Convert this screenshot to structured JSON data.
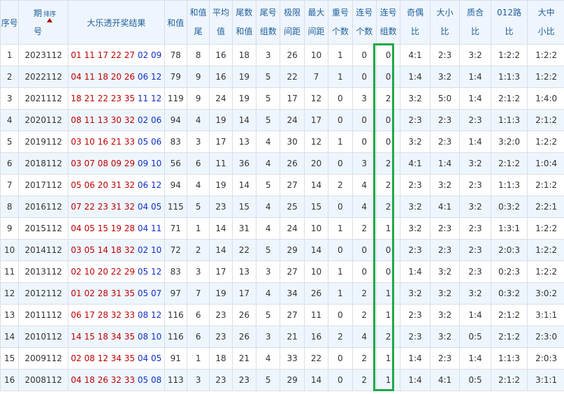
{
  "headers": {
    "xuhao": "序号",
    "qi_top": "期",
    "qi_bottom": "号",
    "sort_label": "排序",
    "result": "大乐透开奖结果",
    "hezhi": "和值",
    "hzw_top": "和值",
    "hzw_bottom": "尾",
    "pj_top": "平均",
    "pj_bottom": "值",
    "wshz_top": "尾数",
    "wshz_bottom": "和值",
    "whzs_top": "尾号",
    "whzs_bottom": "组数",
    "jxjj_top": "极限",
    "jxjj_bottom": "间距",
    "zdjj_top": "最大",
    "zdjj_bottom": "间距",
    "chg_top": "重号",
    "chg_bottom": "个数",
    "lhgs_top": "连号",
    "lhgs_bottom": "个数",
    "lhzs_top": "连号",
    "lhzs_bottom": "组数",
    "jo_top": "奇偶",
    "jo_bottom": "比",
    "dx_top": "大小",
    "dx_bottom": "比",
    "zh_top": "质合",
    "zh_bottom": "比",
    "lu_top": "012路",
    "lu_bottom": "比",
    "dzx_top": "大中",
    "dzx_bottom": "小比"
  },
  "rows": [
    {
      "n": "1",
      "period": "2023112",
      "red": "01 11 17 22 27",
      "blue": "02 09",
      "sum": "78",
      "tail": "8",
      "avg": "16",
      "tsum": "18",
      "tg": "3",
      "jx": "26",
      "zd": "10",
      "ch": "1",
      "lh": "0",
      "lz": "0",
      "jo": "4:1",
      "dx": "2:3",
      "zh": "3:2",
      "lu": "1:2:2",
      "dzx": "1:2:2"
    },
    {
      "n": "2",
      "period": "2022112",
      "red": "04 11 18 20 26",
      "blue": "06 12",
      "sum": "79",
      "tail": "9",
      "avg": "16",
      "tsum": "19",
      "tg": "5",
      "jx": "22",
      "zd": "7",
      "ch": "1",
      "lh": "0",
      "lz": "0",
      "jo": "1:4",
      "dx": "3:2",
      "zh": "1:4",
      "lu": "1:1:3",
      "dzx": "1:2:2"
    },
    {
      "n": "3",
      "period": "2021112",
      "red": "18 21 22 23 35",
      "blue": "11 12",
      "sum": "119",
      "tail": "9",
      "avg": "24",
      "tsum": "19",
      "tg": "5",
      "jx": "17",
      "zd": "12",
      "ch": "0",
      "lh": "3",
      "lz": "2",
      "jo": "3:2",
      "dx": "5:0",
      "zh": "1:4",
      "lu": "2:1:2",
      "dzx": "1:4:0"
    },
    {
      "n": "4",
      "period": "2020112",
      "red": "08 11 13 30 32",
      "blue": "02 06",
      "sum": "94",
      "tail": "4",
      "avg": "19",
      "tsum": "14",
      "tg": "5",
      "jx": "24",
      "zd": "17",
      "ch": "0",
      "lh": "0",
      "lz": "0",
      "jo": "2:3",
      "dx": "2:3",
      "zh": "2:3",
      "lu": "1:1:3",
      "dzx": "2:1:2"
    },
    {
      "n": "5",
      "period": "2019112",
      "red": "03 10 16 21 33",
      "blue": "05 06",
      "sum": "83",
      "tail": "3",
      "avg": "17",
      "tsum": "13",
      "tg": "4",
      "jx": "30",
      "zd": "12",
      "ch": "1",
      "lh": "0",
      "lz": "0",
      "jo": "3:2",
      "dx": "2:3",
      "zh": "1:4",
      "lu": "3:2:0",
      "dzx": "1:2:2"
    },
    {
      "n": "6",
      "period": "2018112",
      "red": "03 07 08 09 29",
      "blue": "09 10",
      "sum": "56",
      "tail": "6",
      "avg": "11",
      "tsum": "36",
      "tg": "4",
      "jx": "26",
      "zd": "20",
      "ch": "0",
      "lh": "3",
      "lz": "2",
      "jo": "4:1",
      "dx": "1:4",
      "zh": "3:2",
      "lu": "2:1:2",
      "dzx": "1:0:4"
    },
    {
      "n": "7",
      "period": "2017112",
      "red": "05 06 20 31 32",
      "blue": "06 12",
      "sum": "94",
      "tail": "4",
      "avg": "19",
      "tsum": "14",
      "tg": "5",
      "jx": "27",
      "zd": "14",
      "ch": "2",
      "lh": "4",
      "lz": "2",
      "jo": "2:3",
      "dx": "3:2",
      "zh": "2:3",
      "lu": "1:1:3",
      "dzx": "2:1:2"
    },
    {
      "n": "8",
      "period": "2016112",
      "red": "07 22 23 31 32",
      "blue": "04 05",
      "sum": "115",
      "tail": "5",
      "avg": "23",
      "tsum": "15",
      "tg": "4",
      "jx": "25",
      "zd": "15",
      "ch": "0",
      "lh": "4",
      "lz": "2",
      "jo": "3:2",
      "dx": "4:1",
      "zh": "3:2",
      "lu": "0:3:2",
      "dzx": "2:2:1"
    },
    {
      "n": "9",
      "period": "2015112",
      "red": "04 05 15 19 28",
      "blue": "04 11",
      "sum": "71",
      "tail": "1",
      "avg": "14",
      "tsum": "31",
      "tg": "4",
      "jx": "24",
      "zd": "10",
      "ch": "1",
      "lh": "2",
      "lz": "1",
      "jo": "3:2",
      "dx": "2:3",
      "zh": "2:3",
      "lu": "1:3:1",
      "dzx": "1:2:2"
    },
    {
      "n": "10",
      "period": "2014112",
      "red": "03 05 14 18 32",
      "blue": "02 10",
      "sum": "72",
      "tail": "2",
      "avg": "14",
      "tsum": "22",
      "tg": "5",
      "jx": "29",
      "zd": "14",
      "ch": "0",
      "lh": "0",
      "lz": "0",
      "jo": "2:3",
      "dx": "2:3",
      "zh": "2:3",
      "lu": "2:0:3",
      "dzx": "1:2:2"
    },
    {
      "n": "11",
      "period": "2013112",
      "red": "02 10 20 22 29",
      "blue": "05 12",
      "sum": "83",
      "tail": "3",
      "avg": "17",
      "tsum": "13",
      "tg": "3",
      "jx": "27",
      "zd": "10",
      "ch": "1",
      "lh": "0",
      "lz": "0",
      "jo": "1:4",
      "dx": "3:2",
      "zh": "2:3",
      "lu": "0:2:3",
      "dzx": "1:2:2"
    },
    {
      "n": "12",
      "period": "2012112",
      "red": "01 02 28 31 35",
      "blue": "05 07",
      "sum": "97",
      "tail": "7",
      "avg": "19",
      "tsum": "17",
      "tg": "4",
      "jx": "34",
      "zd": "26",
      "ch": "1",
      "lh": "2",
      "lz": "1",
      "jo": "3:2",
      "dx": "3:2",
      "zh": "3:2",
      "lu": "0:3:2",
      "dzx": "3:0:2"
    },
    {
      "n": "13",
      "period": "2011112",
      "red": "06 17 28 32 33",
      "blue": "08 12",
      "sum": "116",
      "tail": "6",
      "avg": "23",
      "tsum": "26",
      "tg": "5",
      "jx": "27",
      "zd": "11",
      "ch": "0",
      "lh": "2",
      "lz": "1",
      "jo": "2:3",
      "dx": "3:2",
      "zh": "1:4",
      "lu": "2:1:2",
      "dzx": "3:1:1"
    },
    {
      "n": "14",
      "period": "2010112",
      "red": "14 15 18 34 35",
      "blue": "08 10",
      "sum": "116",
      "tail": "6",
      "avg": "23",
      "tsum": "26",
      "tg": "3",
      "jx": "21",
      "zd": "16",
      "ch": "2",
      "lh": "4",
      "lz": "2",
      "jo": "2:3",
      "dx": "3:2",
      "zh": "0:5",
      "lu": "2:1:2",
      "dzx": "2:3:0"
    },
    {
      "n": "15",
      "period": "2009112",
      "red": "02 08 12 34 35",
      "blue": "04 05",
      "sum": "91",
      "tail": "1",
      "avg": "18",
      "tsum": "21",
      "tg": "4",
      "jx": "33",
      "zd": "22",
      "ch": "0",
      "lh": "2",
      "lz": "1",
      "jo": "1:4",
      "dx": "2:3",
      "zh": "1:4",
      "lu": "1:1:3",
      "dzx": "2:0:3"
    },
    {
      "n": "16",
      "period": "2008112",
      "red": "04 18 26 32 33",
      "blue": "05 08",
      "sum": "113",
      "tail": "3",
      "avg": "23",
      "tsum": "23",
      "tg": "5",
      "jx": "29",
      "zd": "14",
      "ch": "0",
      "lh": "2",
      "lz": "1",
      "jo": "1:4",
      "dx": "4:1",
      "zh": "0:5",
      "lu": "2:1:2",
      "dzx": "3:1:1"
    }
  ],
  "colors": {
    "header_text": "#1f5f9c",
    "red_ball": "#c00000",
    "blue_ball": "#1030c8",
    "highlight": "#1fa84a"
  }
}
